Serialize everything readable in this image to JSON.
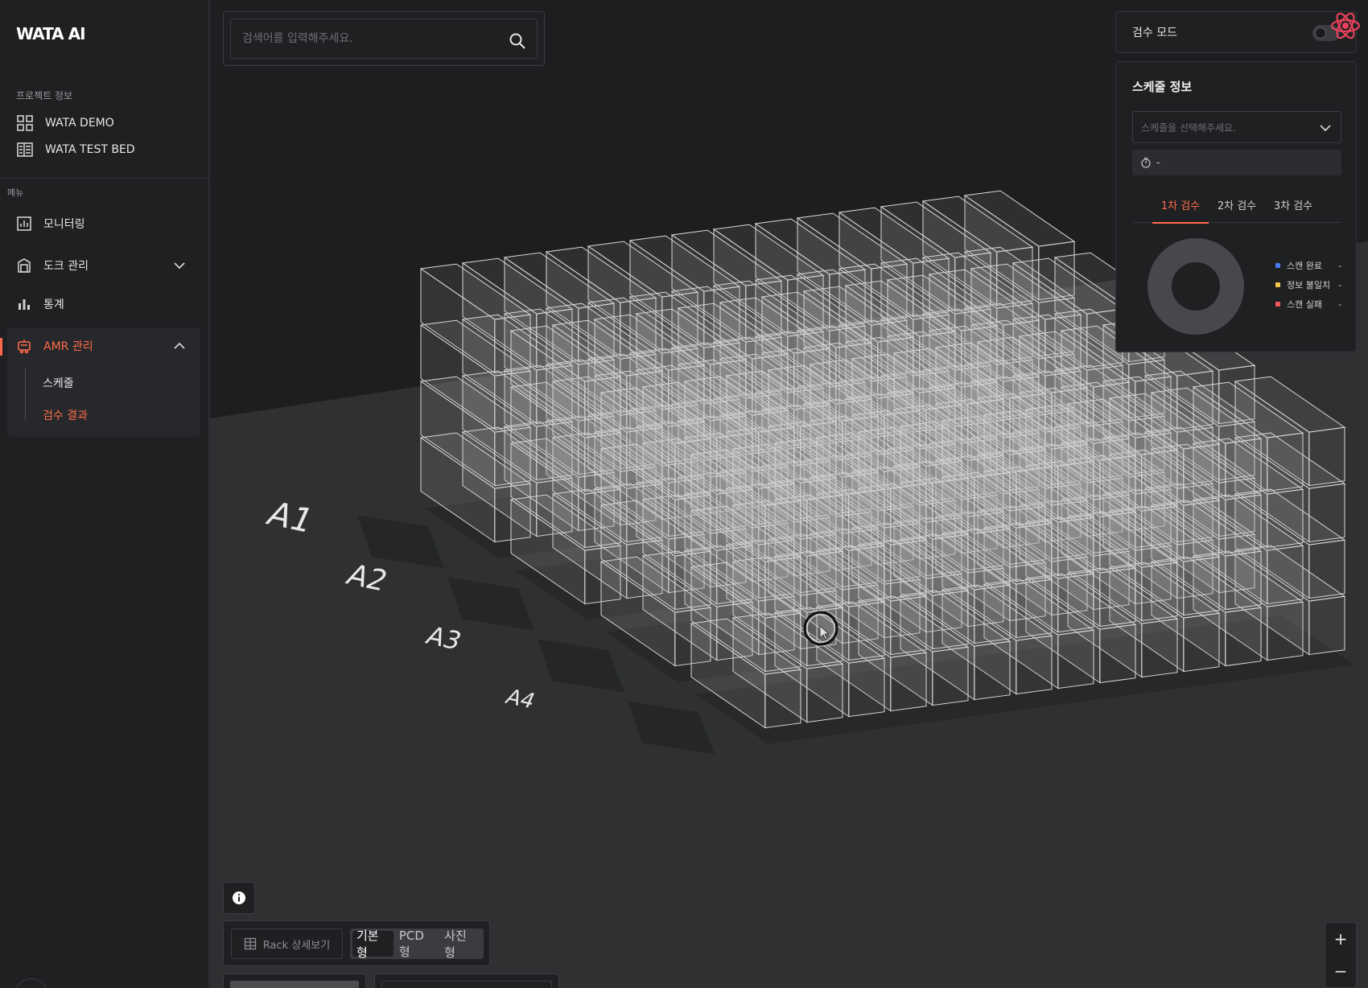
{
  "brand": {
    "logo": "WATA AI"
  },
  "sidebar": {
    "project_label": "프로젝트 정보",
    "projects": [
      {
        "label": "WATA DEMO",
        "icon": "grid-icon"
      },
      {
        "label": "WATA TEST BED",
        "icon": "building-icon"
      }
    ],
    "menu_label": "메뉴",
    "menu": [
      {
        "label": "모니터링",
        "icon": "chart-square-icon"
      },
      {
        "label": "도크 관리",
        "icon": "dock-icon"
      },
      {
        "label": "통계",
        "icon": "bar-chart-icon"
      }
    ],
    "amr": {
      "label": "AMR 관리",
      "children": [
        {
          "label": "스케줄"
        },
        {
          "label": "검수 결과",
          "active": true
        }
      ]
    }
  },
  "search": {
    "placeholder": "검색어를 입력해주세요."
  },
  "inspection_mode": {
    "label": "검수 모드",
    "enabled": false
  },
  "schedule_panel": {
    "title": "스케줄 정보",
    "select_placeholder": "스케줄을 선택해주세요.",
    "time_value": "-",
    "tabs": [
      {
        "label": "1차 검수",
        "active": true
      },
      {
        "label": "2차 검수"
      },
      {
        "label": "3차 검수"
      }
    ],
    "legend": [
      {
        "label": "스캔 완료",
        "value": "-",
        "color": "#4a7cf7"
      },
      {
        "label": "정보 불일치",
        "value": "-",
        "color": "#f2c94c"
      },
      {
        "label": "스캔 실패",
        "value": "-",
        "color": "#eb5757"
      }
    ]
  },
  "viewport": {
    "rack_labels": [
      "A4",
      "A3",
      "A2",
      "A1"
    ]
  },
  "view_controls": {
    "rack_detail_label": "Rack 상세보기",
    "modes": [
      {
        "label": "기본형",
        "active": true
      },
      {
        "label": "PCD형"
      },
      {
        "label": "사진형"
      }
    ]
  },
  "zoom": {
    "in_label": "+",
    "out_label": "−"
  },
  "colors": {
    "accent": "#ff6b4a",
    "panel": "#1f2022",
    "background": "#2a2c2e"
  }
}
